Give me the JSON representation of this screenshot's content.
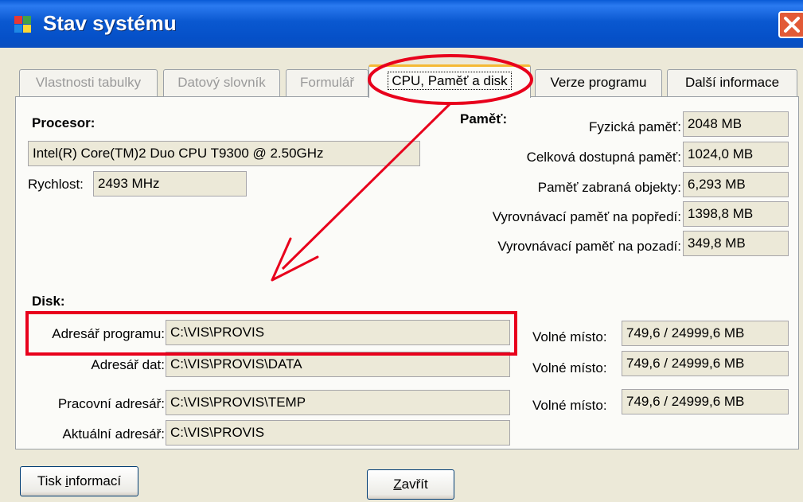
{
  "window": {
    "title": "Stav systému"
  },
  "tabs": [
    {
      "label": "Vlastnosti tabulky"
    },
    {
      "label": "Datový slovník"
    },
    {
      "label": "Formulář"
    },
    {
      "label": "CPU, Paměť a disk"
    },
    {
      "label": "Verze programu"
    },
    {
      "label": "Další informace"
    }
  ],
  "processor": {
    "heading": "Procesor:",
    "name": "Intel(R) Core(TM)2 Duo CPU     T9300  @ 2.50GHz",
    "speed_label": "Rychlost:",
    "speed_value": "2493 MHz"
  },
  "memory": {
    "heading": "Paměť:",
    "rows": [
      {
        "label": "Fyzická paměť:",
        "value": "2048 MB"
      },
      {
        "label": "Celková dostupná paměť:",
        "value": "1024,0 MB"
      },
      {
        "label": "Paměť zabraná objekty:",
        "value": "6,293 MB"
      },
      {
        "label": "Vyrovnávací paměť na popředí:",
        "value": "1398,8 MB"
      },
      {
        "label": "Vyrovnávací paměť na pozadí:",
        "value": "349,8 MB"
      }
    ]
  },
  "disk": {
    "heading": "Disk:",
    "rows": [
      {
        "label": "Adresář programu:",
        "value": "C:\\VIS\\PROVIS",
        "free_label": "Volné místo:",
        "free_value": "749,6 / 24999,6 MB"
      },
      {
        "label": "Adresář dat:",
        "value": "C:\\VIS\\PROVIS\\DATA",
        "free_label": "Volné místo:",
        "free_value": "749,6 / 24999,6 MB"
      },
      {
        "label": "Pracovní adresář:",
        "value": "C:\\VIS\\PROVIS\\TEMP",
        "free_label": "Volné místo:",
        "free_value": "749,6 / 24999,6 MB"
      },
      {
        "label": "Aktuální adresář:",
        "value": "C:\\VIS\\PROVIS"
      }
    ]
  },
  "buttons": {
    "print_pre": "Tisk ",
    "print_key": "i",
    "print_post": "nformací",
    "close_key": "Z",
    "close_post": "avřít"
  },
  "annotation_color": "#e8001c"
}
